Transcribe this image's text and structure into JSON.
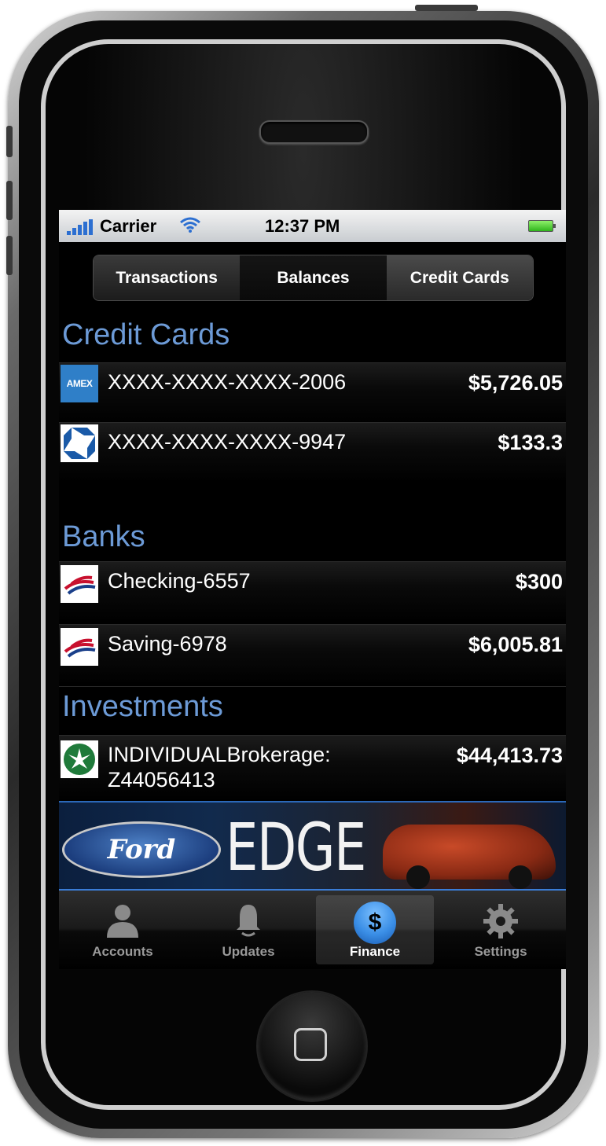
{
  "status_bar": {
    "carrier": "Carrier",
    "time": "12:37 PM"
  },
  "segmented_control": {
    "items": [
      "Transactions",
      "Balances",
      "Credit Cards"
    ],
    "selected": "Credit Cards"
  },
  "sections": {
    "credit_cards": {
      "title": "Credit Cards",
      "items": [
        {
          "logo": "amex-logo",
          "logo_text": "AMEX",
          "label": "XXXX-XXXX-XXXX-2006",
          "amount": "$5,726.05"
        },
        {
          "logo": "chase-logo",
          "label": "XXXX-XXXX-XXXX-9947",
          "amount": "$133.3"
        }
      ]
    },
    "banks": {
      "title": "Banks",
      "items": [
        {
          "logo": "bank-of-america-logo",
          "label": "Checking-6557",
          "amount": "$300"
        },
        {
          "logo": "bank-of-america-logo",
          "label": "Saving-6978",
          "amount": "$6,005.81"
        }
      ]
    },
    "investments": {
      "title": "Investments",
      "items": [
        {
          "logo": "fidelity-logo",
          "label_line1": "INDIVIDUALBrokerage:",
          "label_line2": "Z44056413",
          "amount": "$44,413.73"
        }
      ]
    }
  },
  "ad": {
    "brand": "Ford",
    "text": "EDGE"
  },
  "tab_bar": {
    "tabs": [
      {
        "label": "Accounts",
        "icon": "person-icon"
      },
      {
        "label": "Updates",
        "icon": "bell-icon"
      },
      {
        "label": "Finance",
        "icon": "dollar-icon",
        "icon_text": "$"
      },
      {
        "label": "Settings",
        "icon": "gear-icon"
      }
    ],
    "selected": "Finance"
  },
  "colors": {
    "section_title": "#6c9ad6",
    "status_blue": "#2c6fd1",
    "tab_active_icon": "#3a8ee6"
  }
}
